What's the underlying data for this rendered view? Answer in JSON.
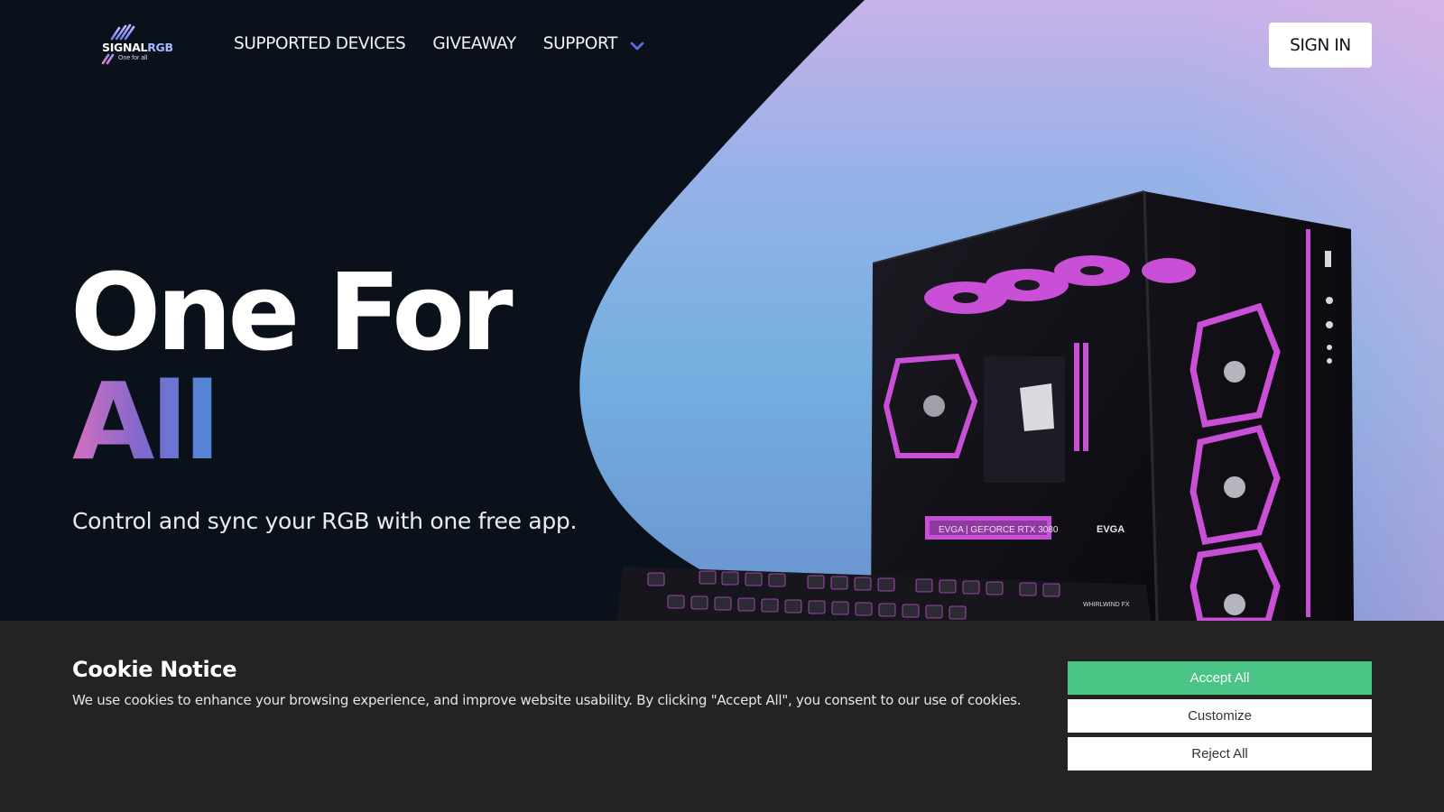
{
  "brand": {
    "wordmark_signal": "SIGNAL",
    "wordmark_rgb": "RGB",
    "tagline": "One for all",
    "accent_pink": "#d56fbf",
    "accent_blue": "#4d89d8"
  },
  "nav": {
    "items": [
      "SUPPORTED DEVICES",
      "GIVEAWAY"
    ],
    "support_label": "SUPPORT",
    "support_icon": "chevron-down-icon",
    "signin_label": "SIGN IN"
  },
  "hero": {
    "title_line1": "One For",
    "title_line2": "All",
    "subtitle": "Control and sync your RGB with one free app.",
    "image_semantic": "RGB gaming PC case with magenta-lit fans and a backlit mechanical keyboard",
    "pc_labels": {
      "gpu_text": "EVGA | GEFORCE RTX 3080",
      "gpu_brand": "EVGA",
      "keyboard_brand": "WHIRLWIND FX"
    }
  },
  "cookie": {
    "title": "Cookie Notice",
    "text": "We use cookies to enhance your browsing experience, and improve website usability. By clicking \"Accept All\", you consent to our use of cookies.",
    "accept_label": "Accept All",
    "customize_label": "Customize",
    "reject_label": "Reject All",
    "accept_color": "#4ac586"
  }
}
